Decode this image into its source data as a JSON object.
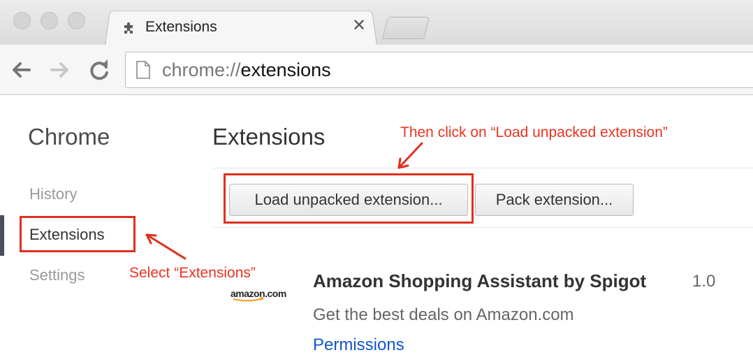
{
  "browser": {
    "tab": {
      "title": "Extensions",
      "close_glyph": "✕",
      "icon": "puzzle-icon"
    },
    "url": {
      "scheme": "chrome://",
      "host": "extensions"
    }
  },
  "sidebar": {
    "title": "Chrome",
    "items": [
      {
        "label": "History"
      },
      {
        "label": "Extensions",
        "selected": true
      },
      {
        "label": "Settings"
      }
    ]
  },
  "main": {
    "title": "Extensions",
    "buttons": {
      "load_unpacked": "Load unpacked extension...",
      "pack": "Pack extension..."
    },
    "extension": {
      "logo_text": "amazon.com",
      "name": "Amazon Shopping Assistant by Spigot",
      "version": "1.0",
      "description": "Get the best deals on Amazon.com",
      "link": "Permissions"
    }
  },
  "annotations": {
    "load_hint": "Then click on “Load unpacked extension”",
    "select_hint": "Select “Extensions”",
    "color": "#e0301e"
  },
  "colors": {
    "link": "#1155cc",
    "sidebar_accent": "#4a4f5a"
  }
}
